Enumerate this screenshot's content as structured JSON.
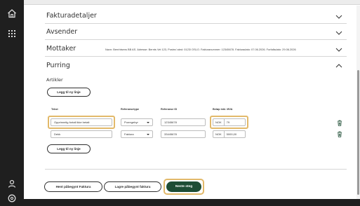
{
  "sidebar": {
    "icons": [
      "home-icon",
      "grid-icon",
      "user-icon",
      "settings-icon"
    ]
  },
  "sections": {
    "fakturadetaljer": "Fakturadetaljer",
    "avsender": "Avsender",
    "mottaker": "Mottaker",
    "mottaker_info": "Navn: Bernhtsens BB AS. Adresse: Bernts Vei 123, Postnr/-sted: 0123/ OSLO. Fakturanummer: 12345678. Fakturadato: 07.06.2026. Forfallsdato: 29.06.2026",
    "purring": "Purring"
  },
  "purring": {
    "artikler_label": "Artikler",
    "add_line_top": "Legg til ny linje",
    "add_line_bottom": "Legg til ny linje",
    "columns": [
      "Tekst",
      "Referansetype",
      "Referanse ID",
      "Beløp inkl. MVA"
    ],
    "rows": [
      {
        "tekst": "Opprinnelig fortall ikke betalt",
        "type": "Purregebyr",
        "ref": "12345678",
        "currency": "NOK",
        "amount": "79"
      },
      {
        "tekst": "Dekk",
        "type": "Faktura",
        "ref": "33445678",
        "currency": "NOK",
        "amount": "5000,00"
      }
    ]
  },
  "footer": {
    "fetch_button": "Hent påbegynt Faktura",
    "save_button": "Lagre påbegynt faktura",
    "next_button": "Neste steg"
  },
  "colors": {
    "primary": "#1e4d35",
    "highlight": "#e2b96a",
    "sidebar": "#1f1f1f"
  }
}
